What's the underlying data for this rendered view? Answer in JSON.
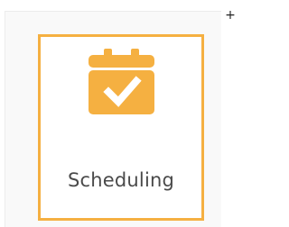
{
  "add_button": {
    "label": "+"
  },
  "tile": {
    "label": "Scheduling",
    "icon": "calendar-check-icon",
    "accent_color": "#f5b041"
  }
}
